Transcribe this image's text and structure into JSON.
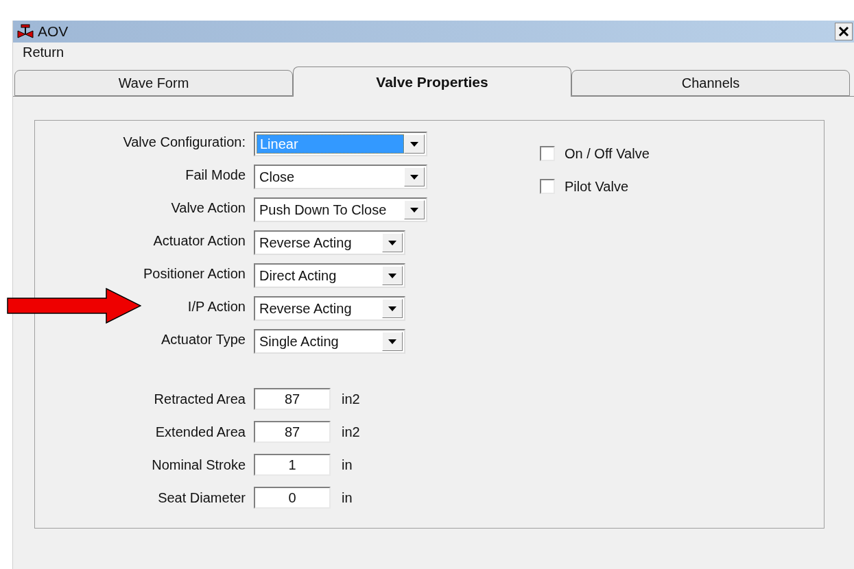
{
  "window": {
    "title": "AOV"
  },
  "menu": [
    "Return"
  ],
  "tabs": [
    {
      "label": "Wave Form",
      "selected": false
    },
    {
      "label": "Valve Properties",
      "selected": true
    },
    {
      "label": "Channels",
      "selected": false
    }
  ],
  "dropdowns": [
    {
      "label": "Valve Configuration:",
      "value": "Linear",
      "focused": true,
      "wide": true
    },
    {
      "label": "Fail Mode",
      "value": "Close",
      "focused": false,
      "wide": true
    },
    {
      "label": "Valve Action",
      "value": "Push Down To Close",
      "focused": false,
      "wide": true
    },
    {
      "label": "Actuator Action",
      "value": "Reverse Acting",
      "focused": false,
      "wide": false
    },
    {
      "label": "Positioner Action",
      "value": "Direct Acting",
      "focused": false,
      "wide": false
    },
    {
      "label": "I/P Action",
      "value": "Reverse Acting",
      "focused": false,
      "wide": false
    },
    {
      "label": "Actuator Type",
      "value": "Single Acting",
      "focused": false,
      "wide": false
    }
  ],
  "fields": [
    {
      "label": "Retracted Area",
      "value": "87",
      "unit": "in2"
    },
    {
      "label": "Extended Area",
      "value": "87",
      "unit": "in2"
    },
    {
      "label": "Nominal Stroke",
      "value": "1",
      "unit": "in"
    },
    {
      "label": "Seat Diameter",
      "value": "0",
      "unit": "in"
    }
  ],
  "checkboxes": [
    {
      "label": "On / Off Valve",
      "checked": false
    },
    {
      "label": "Pilot Valve",
      "checked": false
    }
  ],
  "annotation": {
    "kind": "arrow"
  }
}
